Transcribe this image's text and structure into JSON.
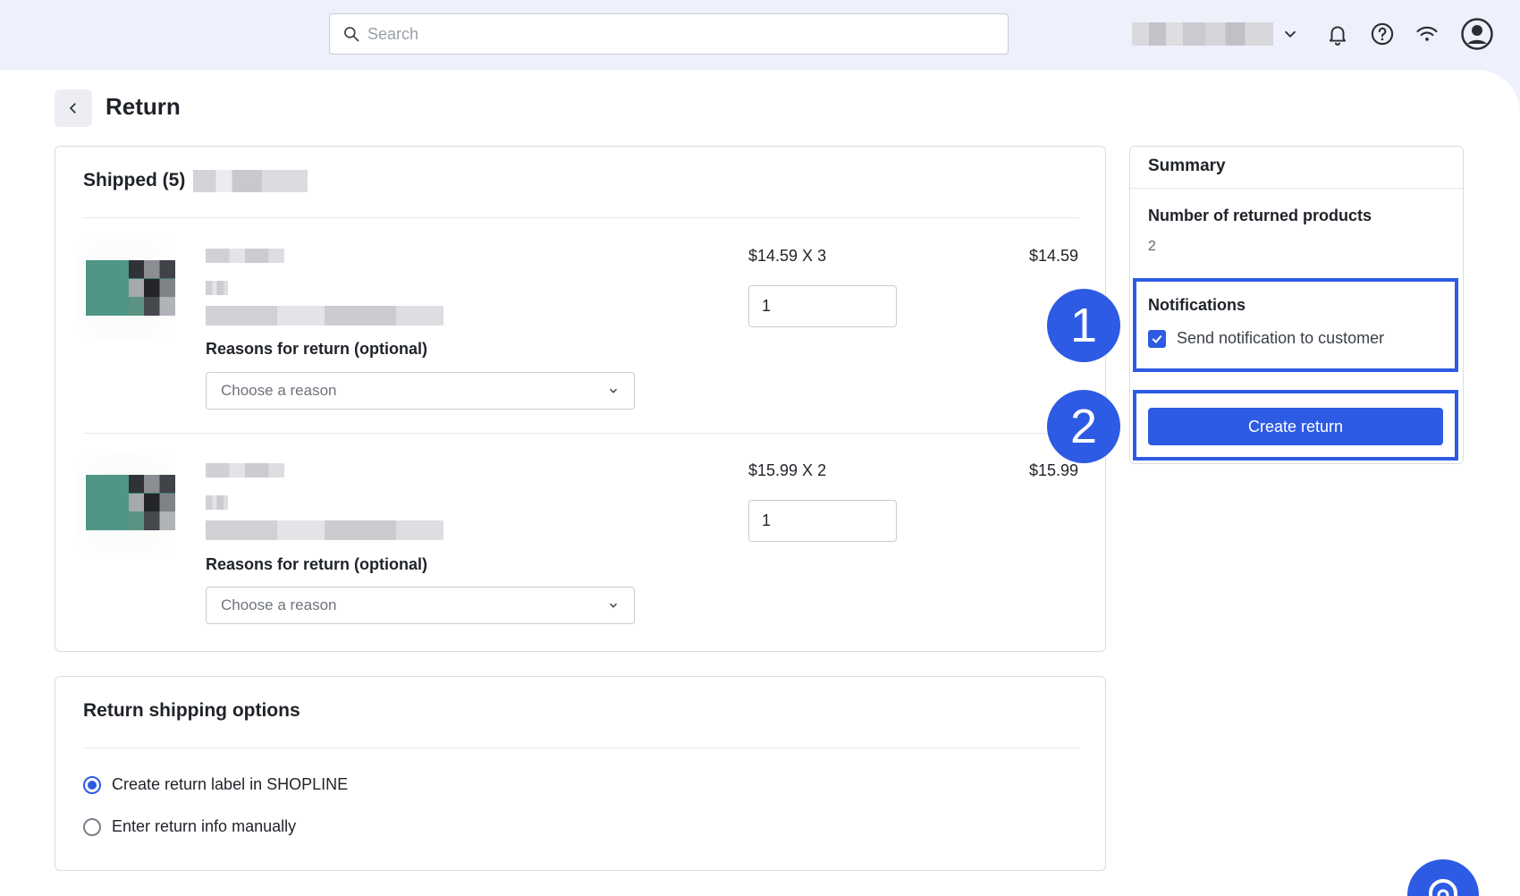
{
  "search": {
    "placeholder": "Search"
  },
  "header": {
    "icons": [
      "chevron-down-icon",
      "bell-icon",
      "help-icon",
      "wifi-icon",
      "user-avatar-icon"
    ]
  },
  "page": {
    "title": "Return"
  },
  "shipped": {
    "title": "Shipped (5)",
    "items": [
      {
        "price_qty": "$14.59 X 3",
        "total": "$14.59",
        "quantity": "1",
        "reason_label": "Reasons for return (optional)",
        "reason_placeholder": "Choose a reason"
      },
      {
        "price_qty": "$15.99 X 2",
        "total": "$15.99",
        "quantity": "1",
        "reason_label": "Reasons for return (optional)",
        "reason_placeholder": "Choose a reason"
      }
    ]
  },
  "shipping": {
    "title": "Return shipping options",
    "options": [
      {
        "label": "Create return label in SHOPLINE",
        "selected": true
      },
      {
        "label": "Enter return info manually",
        "selected": false
      }
    ]
  },
  "summary": {
    "title": "Summary",
    "returned_label": "Number of returned products",
    "returned_value": "2",
    "notifications_title": "Notifications",
    "notify_label": "Send notification to customer",
    "notify_checked": true,
    "create_button": "Create return"
  },
  "annotations": {
    "badge_1": "1",
    "badge_2": "2"
  },
  "colors": {
    "accent": "#2d5be3",
    "topbar": "#eef0fb"
  }
}
